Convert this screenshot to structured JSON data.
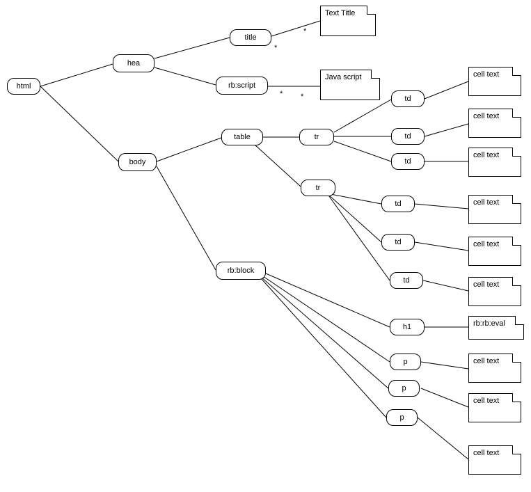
{
  "nodes": {
    "html": "html",
    "hea": "hea",
    "body": "body",
    "title": "title",
    "rbscript": "rb:script",
    "table": "table",
    "rbblock": "rb:block",
    "tr1": "tr",
    "tr2": "tr",
    "td1": "td",
    "td2": "td",
    "td3": "td",
    "td4": "td",
    "td5": "td",
    "td6": "td",
    "h1": "h1",
    "p1": "p",
    "p2": "p",
    "p3": "p"
  },
  "docs": {
    "dTitle": "Text Title",
    "dJs": "Java script",
    "dCell1": "cell text",
    "dCell2": "cell text",
    "dCell3": "cell text",
    "dCell4": "cell text",
    "dCell5": "cell text",
    "dCell6": "cell text",
    "dEval": "rb:rb:eval",
    "dCell7": "cell text",
    "dCell8": "cell text",
    "dCell9": "cell text"
  },
  "stars": {
    "s1": "*",
    "s2": "*",
    "s3": "*",
    "s4": "*"
  }
}
